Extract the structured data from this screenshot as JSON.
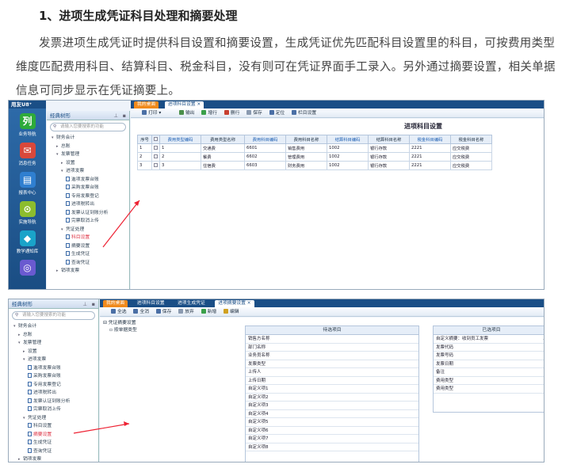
{
  "article": {
    "heading": "1、进项生成凭证科目处理和摘要处理",
    "paragraph": "发票进项生成凭证时提供科目设置和摘要设置，生成凭证优先匹配科目设置里的科目，可按费用类型维度匹配费用科目、结算科目、税金科目，没有则可在凭证界面手工录入。另外通过摘要设置，相关单据信息可同步显示在凭证摘要上。"
  },
  "shot1": {
    "brand": "用友U8⁺",
    "leftnav": [
      {
        "label": "业务导航",
        "icon": "列",
        "color": "#2eaa3a"
      },
      {
        "label": "消息任务",
        "icon": "✉",
        "color": "#d9483b"
      },
      {
        "label": "报表中心",
        "icon": "▤",
        "color": "#2f7fd0"
      },
      {
        "label": "实施导航",
        "icon": "⊙",
        "color": "#8cbd2e"
      },
      {
        "label": "教学通知库",
        "icon": "◆",
        "color": "#1aa3c9"
      },
      {
        "label": "",
        "icon": "◎",
        "color": "#6a5ad0"
      }
    ],
    "tree_title": "经典树形",
    "tree_search": "请输入您要搜索的功能",
    "tree": [
      {
        "label": "财务会计",
        "indent": 1,
        "ar": "▾"
      },
      {
        "label": "总账",
        "indent": 2,
        "ar": "▸"
      },
      {
        "label": "发票管理",
        "indent": 2,
        "ar": "▾"
      },
      {
        "label": "设置",
        "indent": 3,
        "ar": "▸"
      },
      {
        "label": "进项发票",
        "indent": 3,
        "ar": "▾"
      },
      {
        "label": "進项发票台账",
        "indent": 4,
        "doc": true
      },
      {
        "label": "采购发票台账",
        "indent": 4,
        "doc": true
      },
      {
        "label": "专用发票登记",
        "indent": 4,
        "doc": true
      },
      {
        "label": "进项税转出",
        "indent": 4,
        "doc": true
      },
      {
        "label": "发票认证到账分析",
        "indent": 4,
        "doc": true
      },
      {
        "label": "完票取消上传",
        "indent": 4,
        "doc": true
      },
      {
        "label": "凭证处理",
        "indent": 3,
        "ar": "▾"
      },
      {
        "label": "科目设置",
        "indent": 4,
        "doc": true,
        "sel": true
      },
      {
        "label": "摘要设置",
        "indent": 4,
        "doc": true
      },
      {
        "label": "生成凭证",
        "indent": 4,
        "doc": true
      },
      {
        "label": "查询凭证",
        "indent": 4,
        "doc": true
      },
      {
        "label": "销项发票",
        "indent": 2,
        "ar": "▸"
      }
    ],
    "tabs": [
      {
        "label": "我的桌面",
        "type": "home"
      },
      {
        "label": "进项科目设置  ×",
        "type": "active"
      }
    ],
    "toolbar": [
      {
        "label": "打印  ▾",
        "color": "#4a6fa5"
      },
      {
        "label": "输出",
        "color": "#4a8f4a"
      },
      {
        "label": "增行",
        "color": "#3aa04a"
      },
      {
        "label": "删行",
        "color": "#c84030"
      },
      {
        "label": "保存",
        "color": "#8a9ab0"
      },
      {
        "label": "定位",
        "color": "#4a6fa5"
      },
      {
        "label": "栏目设置",
        "color": "#4a6fa5"
      }
    ],
    "page_title": "进项科目设置",
    "columns": [
      "序号",
      "",
      "费用类型编码",
      "费用类型名称",
      "费用科目编码",
      "费用科目名称",
      "结算科目编码",
      "结算科目名称",
      "税金科目编码",
      "税金科目名称"
    ],
    "rows": [
      [
        "1",
        "",
        "1",
        "交通费",
        "6601",
        "销售费用",
        "1002",
        "银行存款",
        "2221",
        "应交税费"
      ],
      [
        "2",
        "",
        "2",
        "餐费",
        "6602",
        "管理费用",
        "1002",
        "银行存款",
        "2221",
        "应交税费"
      ],
      [
        "3",
        "",
        "3",
        "住宿费",
        "6603",
        "财务费用",
        "1002",
        "银行存款",
        "2221",
        "应交税费"
      ]
    ]
  },
  "shot2": {
    "tree_title": "经典树形",
    "tree_search": "请输入您要搜索的功能",
    "tree": [
      {
        "label": "财务会计",
        "indent": 1,
        "ar": "▾"
      },
      {
        "label": "总账",
        "indent": 2,
        "ar": "▸"
      },
      {
        "label": "发票管理",
        "indent": 2,
        "ar": "▾"
      },
      {
        "label": "设置",
        "indent": 3,
        "ar": "▸"
      },
      {
        "label": "进项发票",
        "indent": 3,
        "ar": "▾"
      },
      {
        "label": "進项发票台账",
        "indent": 4,
        "doc": true
      },
      {
        "label": "采购发票台账",
        "indent": 4,
        "doc": true
      },
      {
        "label": "专用发票登记",
        "indent": 4,
        "doc": true
      },
      {
        "label": "进项税转出",
        "indent": 4,
        "doc": true
      },
      {
        "label": "发票认证到账分析",
        "indent": 4,
        "doc": true
      },
      {
        "label": "完票取消上传",
        "indent": 4,
        "doc": true
      },
      {
        "label": "凭证处理",
        "indent": 3,
        "ar": "▾"
      },
      {
        "label": "科目设置",
        "indent": 4,
        "doc": true
      },
      {
        "label": "摘要设置",
        "indent": 4,
        "doc": true,
        "sel": true
      },
      {
        "label": "生成凭证",
        "indent": 4,
        "doc": true
      },
      {
        "label": "查询凭证",
        "indent": 4,
        "doc": true
      },
      {
        "label": "销项发票",
        "indent": 2,
        "ar": "▸"
      }
    ],
    "tabs": [
      {
        "label": "我的桌面",
        "type": "home"
      },
      {
        "label": "进项科目设置",
        "type": "normal"
      },
      {
        "label": "进项生成凭证",
        "type": "normal"
      },
      {
        "label": "进项摘要设置  ×",
        "type": "active"
      }
    ],
    "toolbar": [
      {
        "label": "全选",
        "color": "#4a6fa5"
      },
      {
        "label": "全消",
        "color": "#4a6fa5"
      },
      {
        "label": "保存",
        "color": "#4a6fa5"
      },
      {
        "label": "放弃",
        "color": "#8a9ab0"
      },
      {
        "label": "新增",
        "color": "#3aa04a"
      },
      {
        "label": "编辑",
        "color": "#d0a020"
      }
    ],
    "left_tree": [
      "凭证摘要设置",
      "按单据类型"
    ],
    "available_title": "待选项目",
    "available": [
      "销售方名称",
      "部门名称",
      "业务员名称",
      "发票类型",
      "上传人",
      "上传日期",
      "自定义项1",
      "自定义项2",
      "自定义项3",
      "自定义项4",
      "自定义项5",
      "自定义项6",
      "自定义项7",
      "自定义项8"
    ],
    "selected_title": "已选项目",
    "selected": [
      "自定义摘要：收到员工发票",
      "发票代码",
      "发票号码",
      "发票日期",
      "备注",
      "费用类型",
      "费用类型"
    ]
  }
}
